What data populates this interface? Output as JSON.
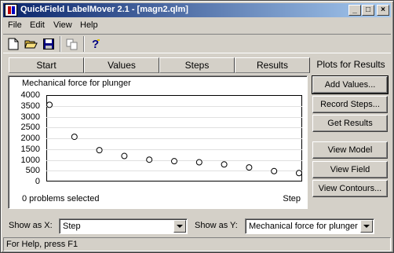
{
  "window": {
    "title": "QuickField LabelMover 2.1 - [magn2.qlm]",
    "controls": [
      "_",
      "□",
      "×"
    ]
  },
  "menu": {
    "items": [
      {
        "label": "File"
      },
      {
        "label": "Edit"
      },
      {
        "label": "View"
      },
      {
        "label": "Help"
      }
    ]
  },
  "toolbar": {
    "buttons": [
      "new-document-icon",
      "open-folder-icon",
      "save-disk-icon",
      "copy-icon",
      "help-icon"
    ]
  },
  "tabs": [
    {
      "label": "Start"
    },
    {
      "label": "Values"
    },
    {
      "label": "Steps"
    },
    {
      "label": "Results"
    }
  ],
  "active_tab": {
    "label": "Plots for Results"
  },
  "chart_data": {
    "type": "scatter",
    "title": "Mechanical force for plunger",
    "xlabel": "Step",
    "ylabel": "",
    "ylim": [
      0,
      4000
    ],
    "yticks": [
      "4000",
      "3500",
      "3000",
      "2500",
      "2000",
      "1500",
      "1000",
      "500",
      "0"
    ],
    "x": [
      1,
      2,
      3,
      4,
      5,
      6,
      7,
      8,
      9,
      10,
      11
    ],
    "values": [
      3550,
      2070,
      1450,
      1180,
      1010,
      940,
      890,
      790,
      650,
      480,
      390
    ],
    "grid": true,
    "marker": "open-circle"
  },
  "chart_footer": {
    "selection_status": "0 problems selected"
  },
  "side_buttons": [
    {
      "label": "Add Values..."
    },
    {
      "label": "Record Steps..."
    },
    {
      "label": "Get Results"
    },
    {
      "label": "View Model"
    },
    {
      "label": "View Field"
    },
    {
      "label": "View Contours..."
    }
  ],
  "show_as_x": {
    "label": "Show as X:",
    "value": "Step"
  },
  "show_as_y": {
    "label": "Show as Y:",
    "value": "Mechanical force for plunger"
  },
  "status_bar": {
    "text": "For Help, press F1"
  }
}
